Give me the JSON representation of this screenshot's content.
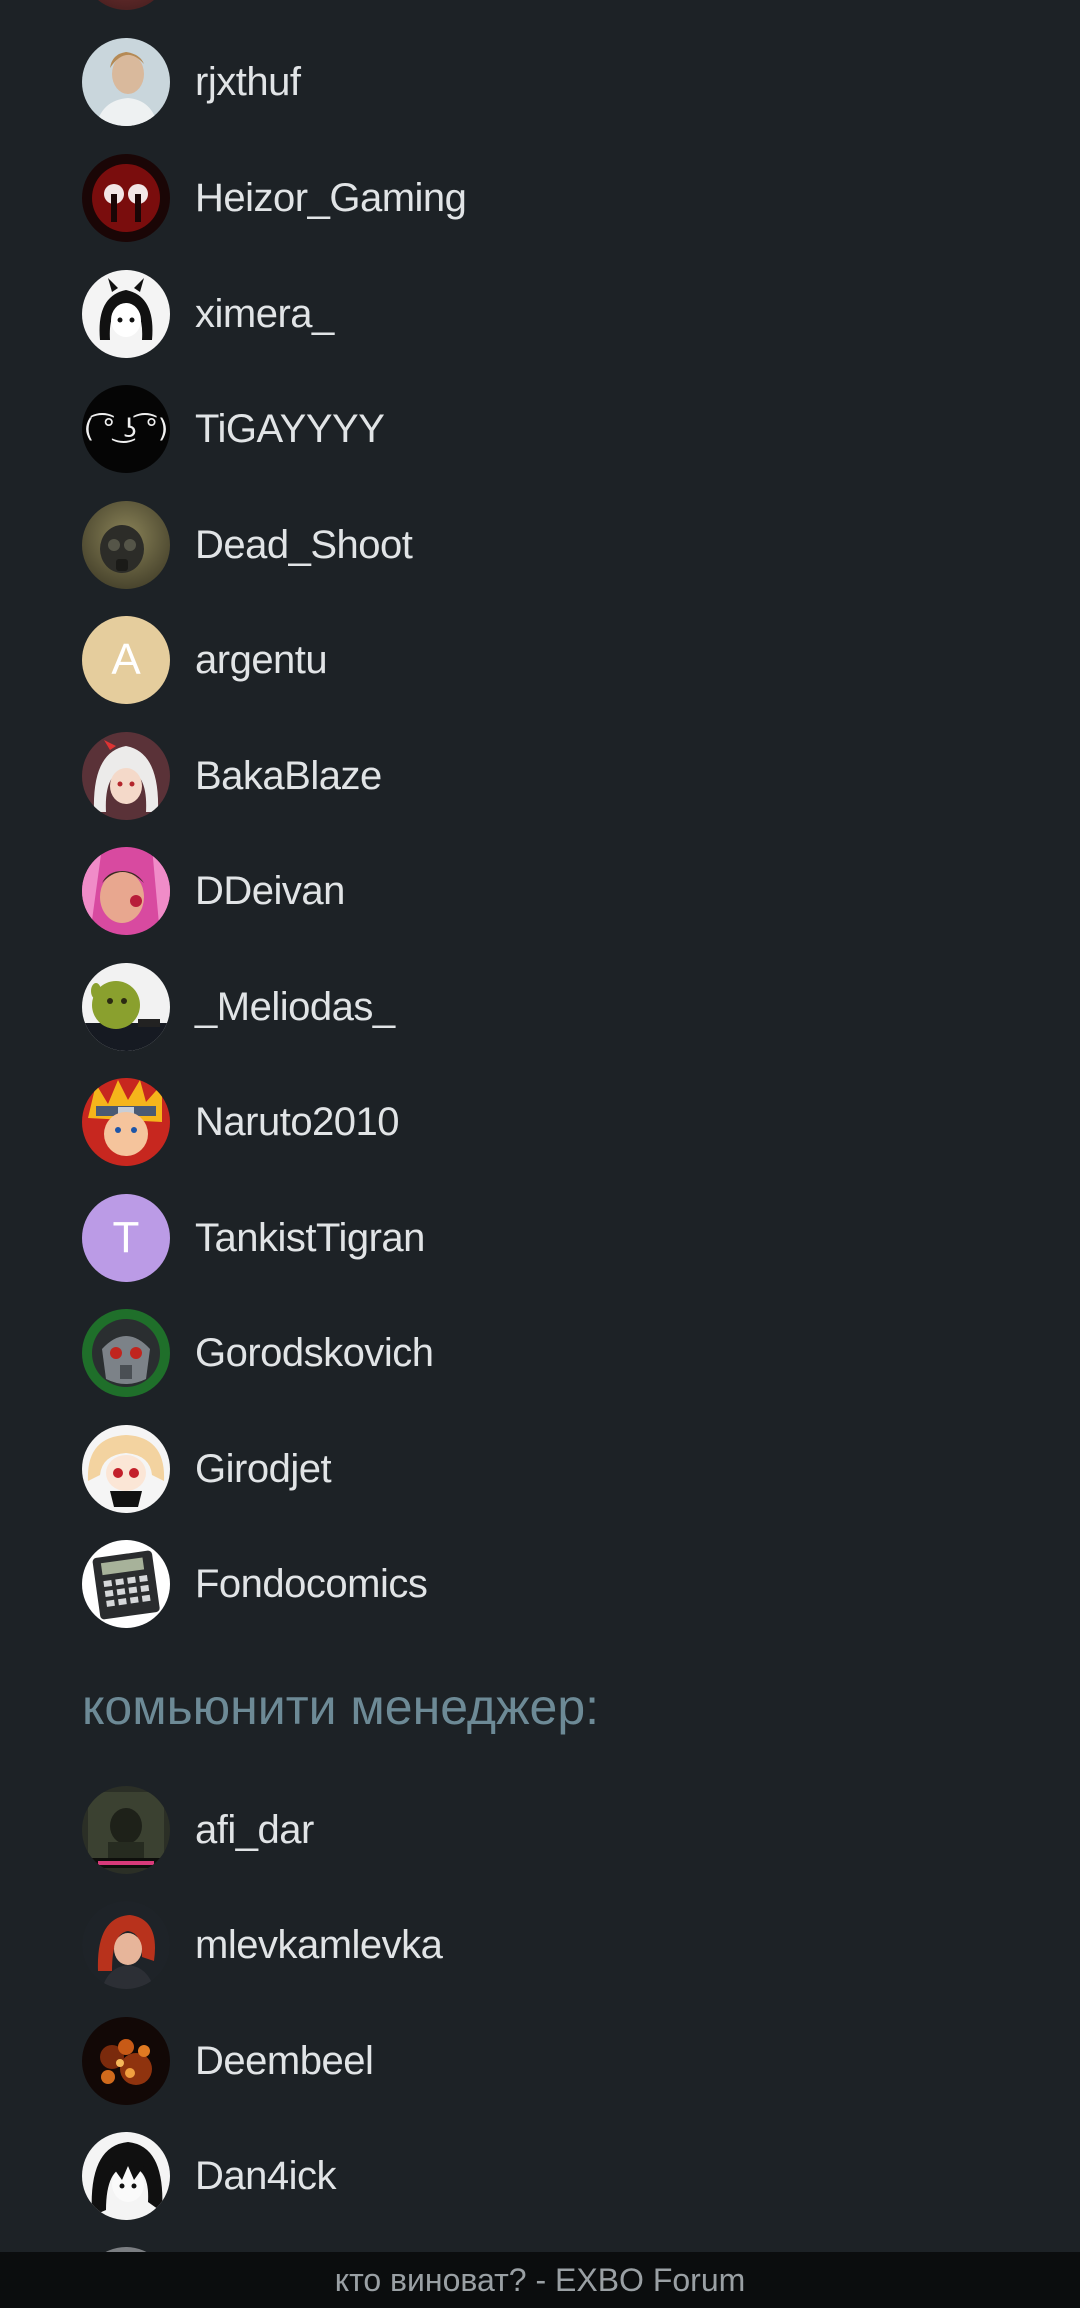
{
  "users": [
    {
      "name": "rjxthuf",
      "avatar": "photo-man-icon"
    },
    {
      "name": "Heizor_Gaming",
      "avatar": "red-eyes-icon"
    },
    {
      "name": "ximera_",
      "avatar": "anime-girl-icon"
    },
    {
      "name": "TiGAYYYY",
      "avatar": "lenny-face-icon"
    },
    {
      "name": "Dead_Shoot",
      "avatar": "gas-mask-icon"
    },
    {
      "name": "argentu",
      "avatar_letter": "A",
      "avatar_color": "#e5cd9d"
    },
    {
      "name": "BakaBlaze",
      "avatar": "anime-white-hair-icon"
    },
    {
      "name": "DDeivan",
      "avatar": "pink-photo-icon"
    },
    {
      "name": "_Meliodas_",
      "avatar": "shrek-icon"
    },
    {
      "name": "Naruto2010",
      "avatar": "naruto-icon"
    },
    {
      "name": "TankistTigran",
      "avatar_letter": "T",
      "avatar_color": "#bb9be6"
    },
    {
      "name": "Gorodskovich",
      "avatar": "helmet-icon"
    },
    {
      "name": "Girodjet",
      "avatar": "anime-blonde-icon"
    },
    {
      "name": "Fondocomics",
      "avatar": "calculator-icon"
    }
  ],
  "section": {
    "title": "комьюнити менеджер:"
  },
  "managers": [
    {
      "name": "afi_dar",
      "avatar": "soldier-icon"
    },
    {
      "name": "mlevkamlevka",
      "avatar": "red-hair-girl-icon"
    },
    {
      "name": "Deembeel",
      "avatar": "fire-icon"
    },
    {
      "name": "Dan4ick",
      "avatar": "anime-black-hair-icon"
    }
  ],
  "footer": {
    "title": "кто виноват? - EXBO Forum"
  },
  "colors": {
    "background": "#1d2226",
    "section_title": "#6d8a96",
    "username": "#e1e4e6",
    "footer_bg": "#0b0d0e"
  }
}
